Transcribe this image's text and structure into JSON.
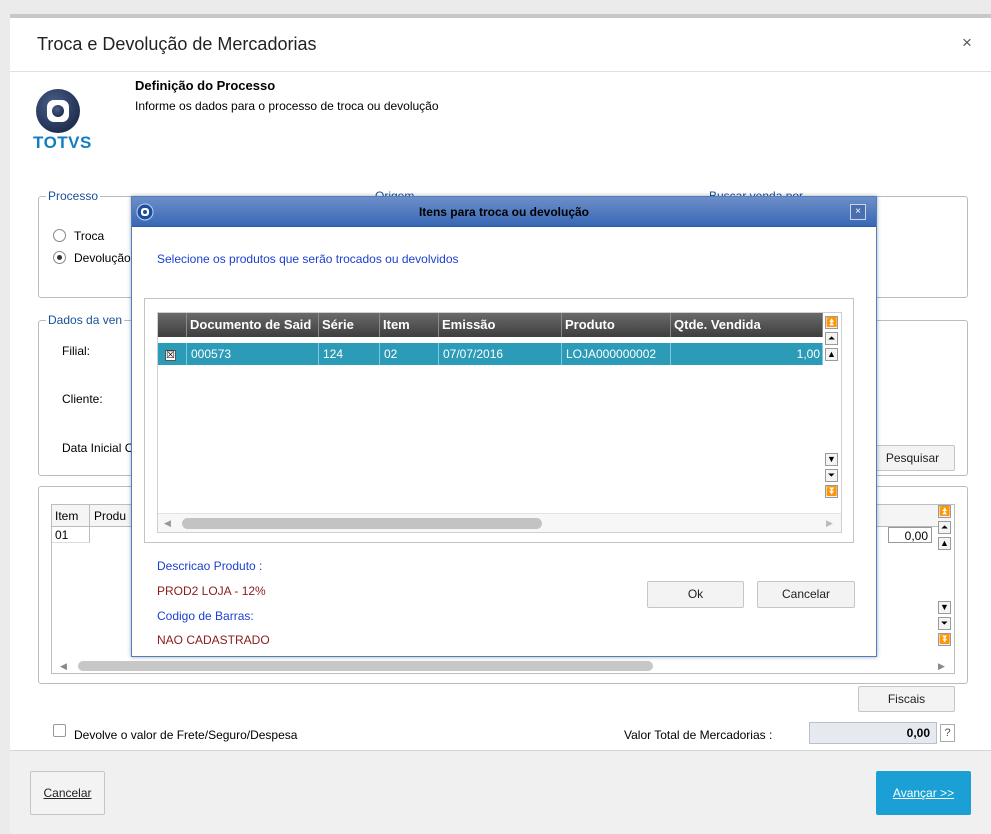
{
  "window": {
    "title": "Troca e Devolução de Mercadorias",
    "close_glyph": "×"
  },
  "header": {
    "title": "Definição do Processo",
    "subtitle": "Informe os dados para o processo de troca ou devolução",
    "logo_text": "TOTVS"
  },
  "processo": {
    "label": "Processo",
    "options": [
      {
        "label": "Troca",
        "selected": false
      },
      {
        "label": "Devolução",
        "selected": true
      }
    ]
  },
  "origem": {
    "label": "Origem"
  },
  "buscar": {
    "label": "Buscar venda por"
  },
  "dados_venda": {
    "label": "Dados da ven",
    "filial_label": "Filial:",
    "cliente_label": "Cliente:",
    "data_label": "Data Inicial C",
    "pesquisar_label": "Pesquisar"
  },
  "items_grid": {
    "columns": [
      "Item",
      "Produ"
    ],
    "rows": [
      {
        "item": "01",
        "valor": "0,00"
      }
    ]
  },
  "fiscais_label": "Fiscais",
  "frete_checkbox": {
    "label": "Devolve o valor de Frete/Seguro/Despesa",
    "checked": false
  },
  "valor_total": {
    "label": "Valor Total de Mercadorias :",
    "value": "0,00",
    "help": "?"
  },
  "footer": {
    "cancel_label": "Cancelar",
    "next_label": "Avançar >>"
  },
  "dialog": {
    "title": "Itens para troca ou devolução",
    "instruction": "Selecione os produtos que serão trocados ou devolvidos",
    "columns": [
      "Documento de Said",
      "Série",
      "Item",
      "Emissão",
      "Produto",
      "Qtde. Vendida"
    ],
    "rows": [
      {
        "documento": "000573",
        "serie": "124",
        "item": "02",
        "emissao": "07/07/2016",
        "produto": "LOJA000000002",
        "qtde": "1,00",
        "checked": true
      }
    ],
    "desc_label": "Descricao Produto :",
    "desc_value": "PROD2 LOJA - 12%",
    "barcode_label": "Codigo de Barras:",
    "barcode_value": "NAO CADASTRADO",
    "ok_label": "Ok",
    "cancel_label": "Cancelar"
  },
  "colors": {
    "accent": "#2b9bb8",
    "header_dark": "#3e3e3e",
    "label_blue": "#1d3fcf",
    "value_red": "#8b1a1a",
    "next_button": "#1aa0d4"
  }
}
